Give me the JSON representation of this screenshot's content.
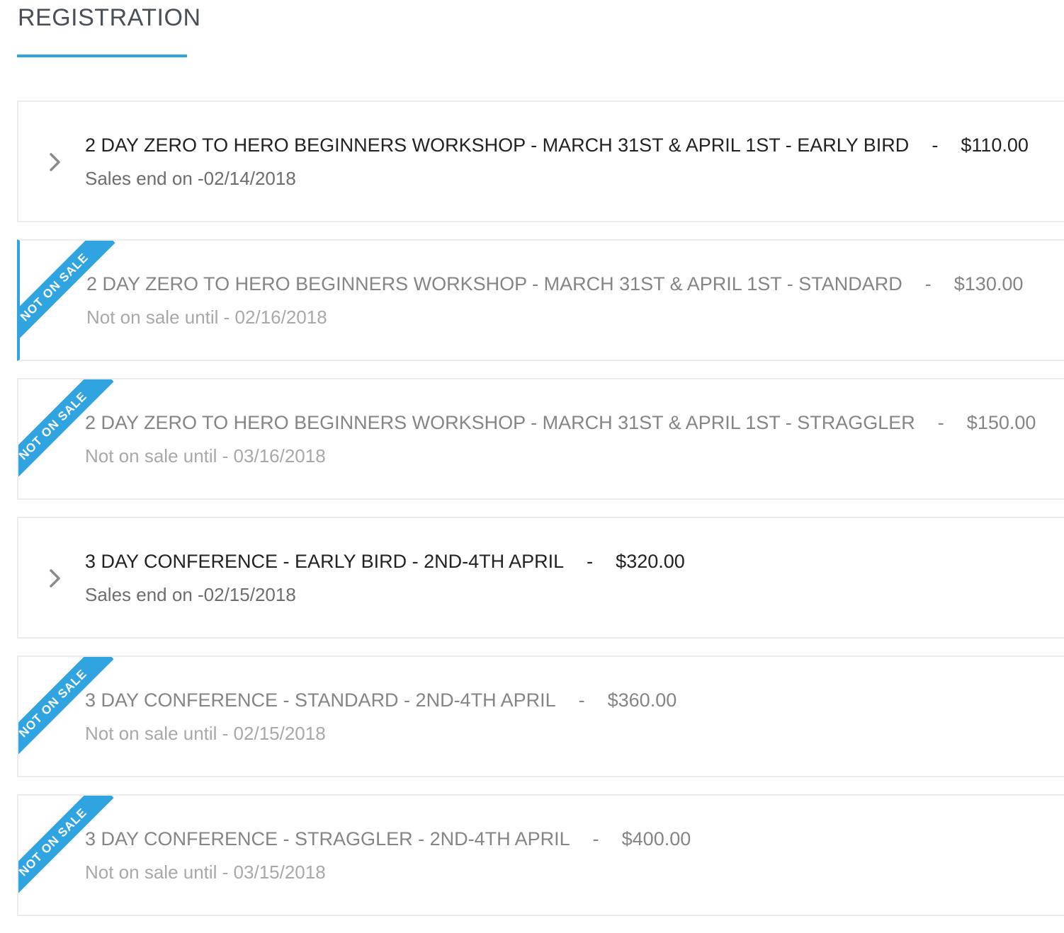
{
  "section": {
    "title": "REGISTRATION"
  },
  "colors": {
    "accent": "#2fa4e0",
    "text": "#222222",
    "muted": "#858585"
  },
  "tickets": [
    {
      "name": "2 DAY ZERO TO HERO BEGINNERS WORKSHOP - MARCH 31ST & APRIL 1ST - EARLY BIRD",
      "separator": "-",
      "price": "$110.00",
      "status_text": "Sales end on -02/14/2018",
      "on_sale": true,
      "ribbon": "",
      "icon": "chevron-right-icon"
    },
    {
      "name": "2 DAY ZERO TO HERO BEGINNERS WORKSHOP - MARCH 31ST & APRIL 1ST - STANDARD",
      "separator": "-",
      "price": "$130.00",
      "status_text": "Not on sale until - 02/16/2018",
      "on_sale": false,
      "ribbon": "NOT ON SALE"
    },
    {
      "name": "2 DAY ZERO TO HERO BEGINNERS WORKSHOP - MARCH 31ST & APRIL 1ST - STRAGGLER",
      "separator": "-",
      "price": "$150.00",
      "status_text": "Not on sale until - 03/16/2018",
      "on_sale": false,
      "ribbon": "NOT ON SALE"
    },
    {
      "name": "3 DAY CONFERENCE - EARLY BIRD - 2ND-4TH APRIL",
      "separator": "-",
      "price": "$320.00",
      "status_text": "Sales end on -02/15/2018",
      "on_sale": true,
      "ribbon": "",
      "icon": "chevron-right-icon"
    },
    {
      "name": "3 DAY CONFERENCE - STANDARD - 2ND-4TH APRIL",
      "separator": "-",
      "price": "$360.00",
      "status_text": "Not on sale until - 02/15/2018",
      "on_sale": false,
      "ribbon": "NOT ON SALE"
    },
    {
      "name": "3 DAY CONFERENCE - STRAGGLER - 2ND-4TH APRIL",
      "separator": "-",
      "price": "$400.00",
      "status_text": "Not on sale until - 03/15/2018",
      "on_sale": false,
      "ribbon": "NOT ON SALE"
    }
  ]
}
